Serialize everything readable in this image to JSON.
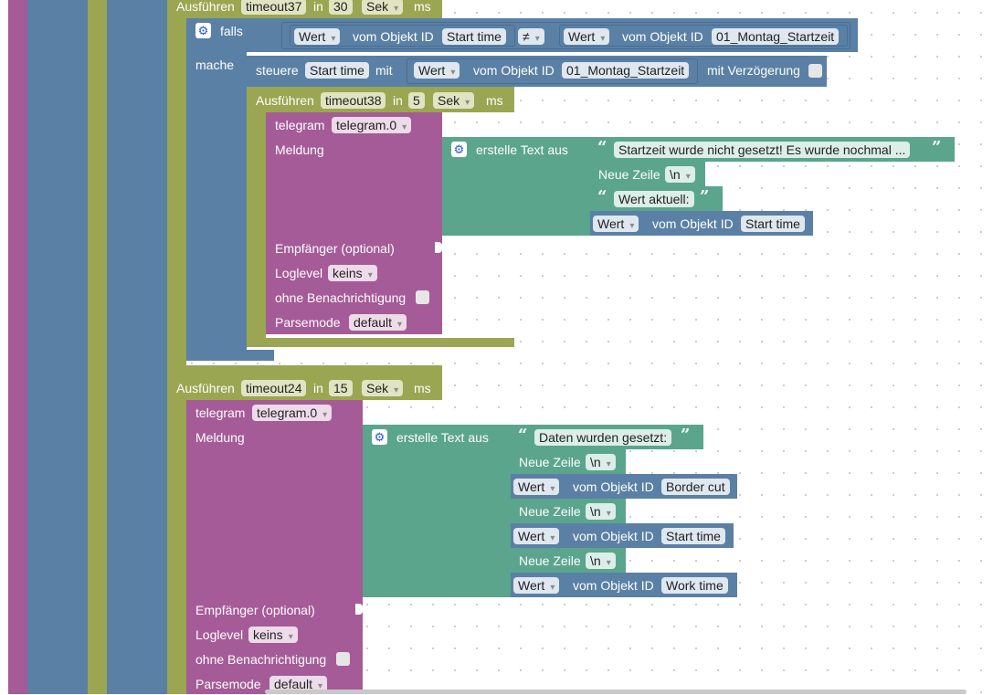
{
  "run": {
    "label": "Ausführen",
    "in": "in",
    "ms": "ms"
  },
  "timeouts": {
    "t37": {
      "name": "timeout37",
      "delay": "30",
      "unit": "Sek"
    },
    "t38": {
      "name": "timeout38",
      "delay": "5",
      "unit": "Sek"
    },
    "t24": {
      "name": "timeout24",
      "delay": "15",
      "unit": "Sek"
    }
  },
  "if_block": {
    "falls": "falls",
    "mache": "mache",
    "neq": "≠"
  },
  "value": {
    "wert": "Wert",
    "vom_objekt": "vom Objekt ID"
  },
  "objects": {
    "start_time": "Start time",
    "montag": "01_Montag_Startzeit",
    "border_cut": "Border cut",
    "work_time": "Work time"
  },
  "control": {
    "label": "steuere",
    "mit": "mit",
    "delay": "mit Verzögerung"
  },
  "telegram": {
    "label": "telegram",
    "instance": "telegram.0",
    "meldung": "Meldung",
    "empfaenger": "Empfänger (optional)",
    "loglevel": "Loglevel",
    "loglevel_value": "keins",
    "silent": "ohne Benachrichtigung",
    "parsemode": "Parsemode",
    "parsemode_value": "default"
  },
  "text": {
    "create": "erstelle Text aus",
    "newline": "Neue Zeile",
    "newline_value": "\\n",
    "msg_start": "Startzeit wurde nicht gesetzt! Es wurde nochmal ...",
    "msg_value": "Wert aktuell:",
    "msg_data": "Daten wurden gesetzt:"
  },
  "icons": {
    "gear": "gear-icon",
    "dropdown": "chevron-down-icon"
  },
  "colors": {
    "purple": "#a55b97",
    "blue": "#5b80a5",
    "olive": "#9aa651",
    "green": "#5ba58c"
  }
}
